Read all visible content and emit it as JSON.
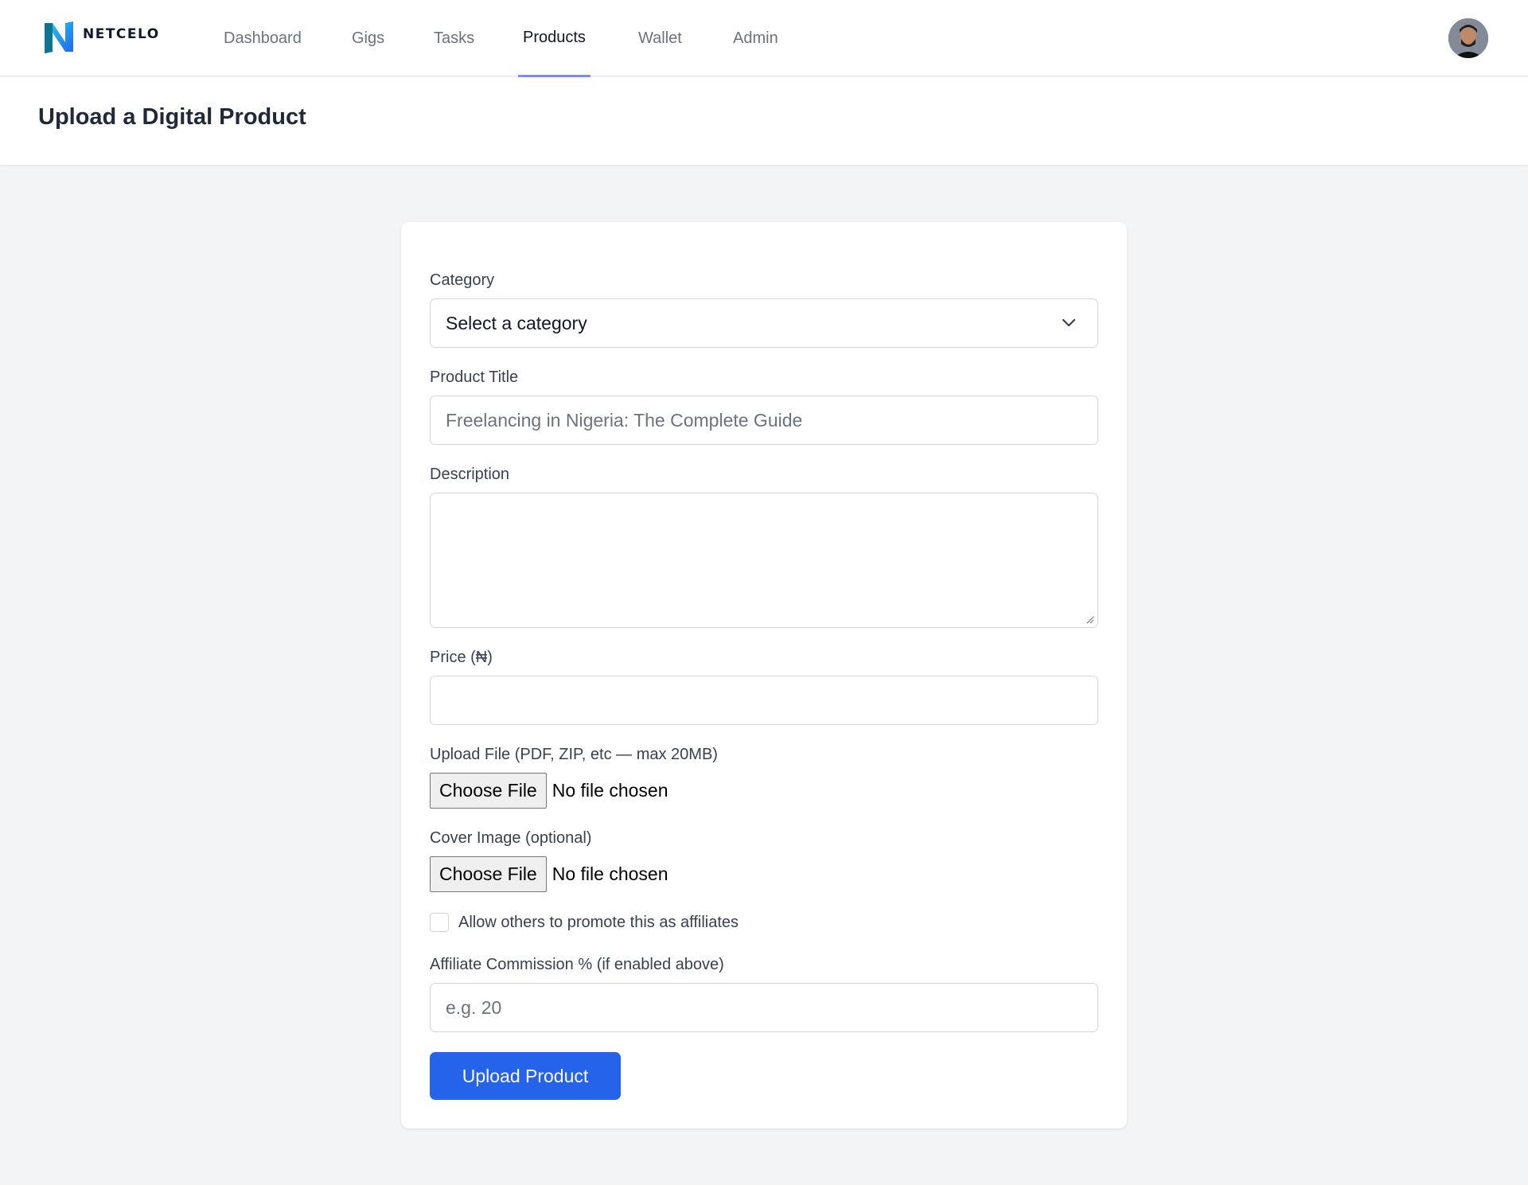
{
  "brand": {
    "name": "NETCELO"
  },
  "nav": {
    "items": [
      {
        "label": "Dashboard"
      },
      {
        "label": "Gigs"
      },
      {
        "label": "Tasks"
      },
      {
        "label": "Products",
        "active": true
      },
      {
        "label": "Wallet"
      },
      {
        "label": "Admin"
      }
    ]
  },
  "page": {
    "title": "Upload a Digital Product"
  },
  "form": {
    "category": {
      "label": "Category",
      "value": "Select a category"
    },
    "title": {
      "label": "Product Title",
      "placeholder": "Freelancing in Nigeria: The Complete Guide"
    },
    "description": {
      "label": "Description",
      "value": ""
    },
    "price": {
      "label": "Price (₦)",
      "value": ""
    },
    "upload_file": {
      "label": "Upload File (PDF, ZIP, etc — max 20MB)",
      "button": "Choose File",
      "status": "No file chosen"
    },
    "cover_image": {
      "label": "Cover Image (optional)",
      "button": "Choose File",
      "status": "No file chosen"
    },
    "affiliate_checkbox": {
      "label": "Allow others to promote this as affiliates",
      "checked": false
    },
    "commission": {
      "label": "Affiliate Commission % (if enabled above)",
      "placeholder": "e.g. 20"
    },
    "submit": "Upload Product"
  },
  "colors": {
    "accent": "#2563eb",
    "active_tab_underline": "#818cf8",
    "background": "#f3f4f6"
  }
}
